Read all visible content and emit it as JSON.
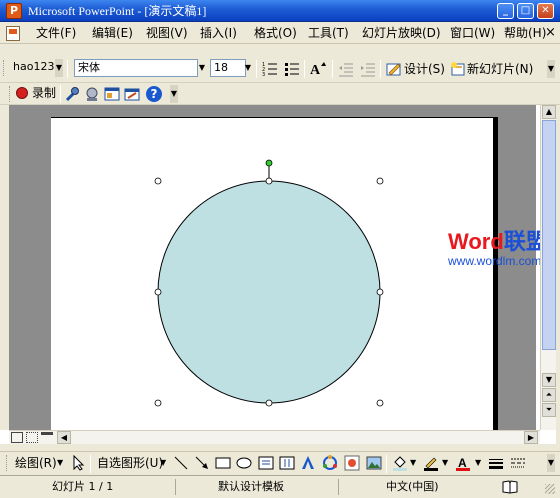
{
  "window": {
    "title": "Microsoft PowerPoint - [演示文稿1]"
  },
  "menubar": {
    "items": [
      {
        "label": "文件(F)"
      },
      {
        "label": "编辑(E)"
      },
      {
        "label": "视图(V)"
      },
      {
        "label": "插入(I)"
      },
      {
        "label": "格式(O)"
      },
      {
        "label": "工具(T)"
      },
      {
        "label": "幻灯片放映(D)"
      },
      {
        "label": "窗口(W)"
      },
      {
        "label": "帮助(H)"
      }
    ],
    "close_glyph": "×"
  },
  "toolbar": {
    "style_box": "hao123",
    "font_name": "宋体",
    "font_size": "18",
    "design_label": "设计(S)",
    "new_slide_label": "新幻灯片(N)"
  },
  "toolbar2": {
    "record_label": "录制"
  },
  "drawing": {
    "draw_label": "绘图(R)",
    "autoshape_label": "自选图形(U)"
  },
  "status": {
    "slide": "幻灯片 1 / 1",
    "template": "默认设计模板",
    "language": "中文(中国)"
  },
  "watermark": {
    "word": "Word",
    "cn": "联盟",
    "url": "www.wordlm.com"
  },
  "colors": {
    "circle_fill": "#bfe0e3",
    "rotate_handle": "#33cc33",
    "watermark_red": "#e8191e",
    "watermark_blue": "#1a4fd6"
  }
}
